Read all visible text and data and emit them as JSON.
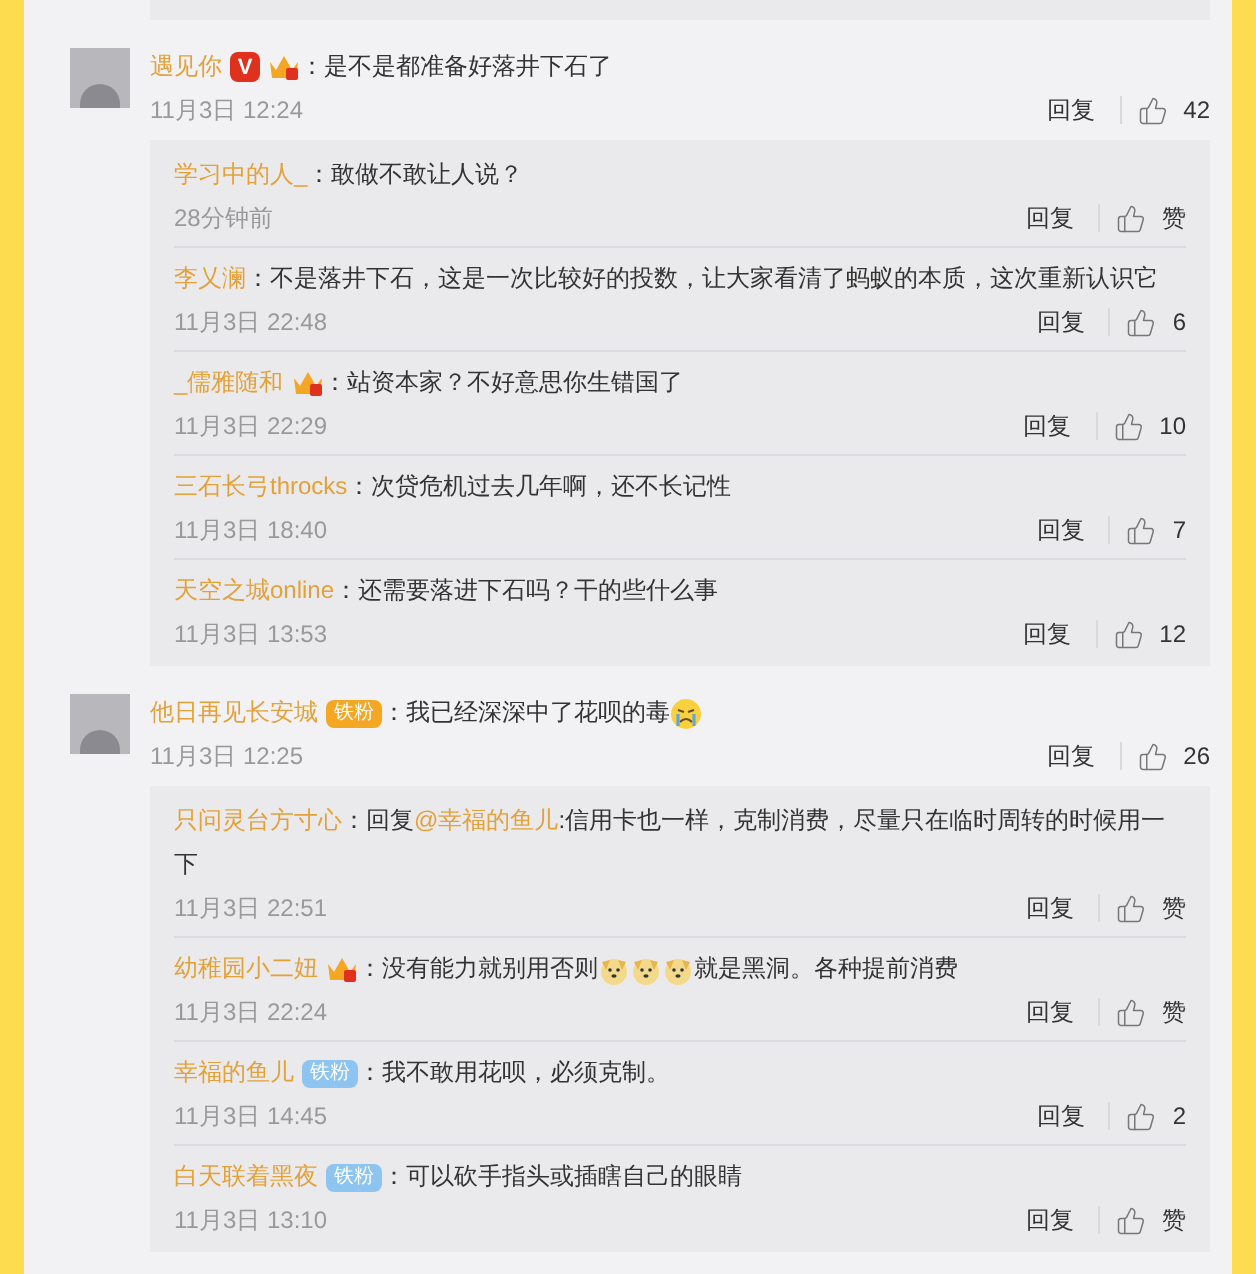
{
  "comments": [
    {
      "name": "遇见你",
      "badges": [
        {
          "kind": "v",
          "text": "V"
        },
        {
          "kind": "crown"
        }
      ],
      "parts": [
        {
          "kind": "text",
          "text": "：是不是都准备好落井下石了"
        }
      ],
      "time": "11月3日 12:24",
      "reply_label": "回复",
      "likes": "42",
      "replies": [
        {
          "name": "学习中的人_",
          "parts": [
            {
              "kind": "text",
              "text": "：敢做不敢让人说？"
            }
          ],
          "time": "28分钟前",
          "reply_label": "回复",
          "likes": "赞"
        },
        {
          "name": "李乂澜",
          "parts": [
            {
              "kind": "text",
              "text": "：不是落井下石，这是一次比较好的投数，让大家看清了蚂蚁的本质，这次重新认识它"
            }
          ],
          "time": "11月3日 22:48",
          "reply_label": "回复",
          "likes": "6"
        },
        {
          "name": "_儒雅随和",
          "badges": [
            {
              "kind": "crown"
            }
          ],
          "parts": [
            {
              "kind": "text",
              "text": "：站资本家？不好意思你生错国了"
            }
          ],
          "time": "11月3日 22:29",
          "reply_label": "回复",
          "likes": "10"
        },
        {
          "name": "三石长弓throcks",
          "parts": [
            {
              "kind": "text",
              "text": "：次贷危机过去几年啊，还不长记性"
            }
          ],
          "time": "11月3日 18:40",
          "reply_label": "回复",
          "likes": "7"
        },
        {
          "name": "天空之城online",
          "parts": [
            {
              "kind": "text",
              "text": "：还需要落进下石吗？干的些什么事"
            }
          ],
          "time": "11月3日 13:53",
          "reply_label": "回复",
          "likes": "12"
        }
      ]
    },
    {
      "name": "他日再见长安城",
      "badges": [
        {
          "kind": "fan",
          "text": "铁粉",
          "color": "#f5a623"
        }
      ],
      "parts": [
        {
          "kind": "text",
          "text": "：我已经深深中了花呗的毒"
        },
        {
          "kind": "crying_emoji"
        }
      ],
      "time": "11月3日 12:25",
      "reply_label": "回复",
      "likes": "26",
      "replies": [
        {
          "name": "只问灵台方寸心",
          "parts": [
            {
              "kind": "text",
              "text": "：回复"
            },
            {
              "kind": "mention",
              "text": "@幸福的鱼儿"
            },
            {
              "kind": "text",
              "text": ":信用卡也一样，克制消费，尽量只在临时周转的时候用一下"
            }
          ],
          "time": "11月3日 22:51",
          "reply_label": "回复",
          "likes": "赞"
        },
        {
          "name": "幼稚园小二妞",
          "badges": [
            {
              "kind": "crown"
            }
          ],
          "parts": [
            {
              "kind": "text",
              "text": "：没有能力就别用否则"
            },
            {
              "kind": "dog_emoji"
            },
            {
              "kind": "dog_emoji"
            },
            {
              "kind": "dog_emoji"
            },
            {
              "kind": "text",
              "text": "就是黑洞。各种提前消费"
            }
          ],
          "time": "11月3日 22:24",
          "reply_label": "回复",
          "likes": "赞"
        },
        {
          "name": "幸福的鱼儿",
          "badges": [
            {
              "kind": "fan",
              "text": "铁粉",
              "color": "#8ec5f0"
            }
          ],
          "parts": [
            {
              "kind": "text",
              "text": "：我不敢用花呗，必须克制。"
            }
          ],
          "time": "11月3日 14:45",
          "reply_label": "回复",
          "likes": "2"
        },
        {
          "name": "白天联着黑夜",
          "badges": [
            {
              "kind": "fan",
              "text": "铁粉",
              "color": "#8ec5f0"
            }
          ],
          "parts": [
            {
              "kind": "text",
              "text": "：可以砍手指头或插瞎自己的眼睛"
            }
          ],
          "time": "11月3日 13:10",
          "reply_label": "回复",
          "likes": "赞"
        }
      ]
    }
  ]
}
